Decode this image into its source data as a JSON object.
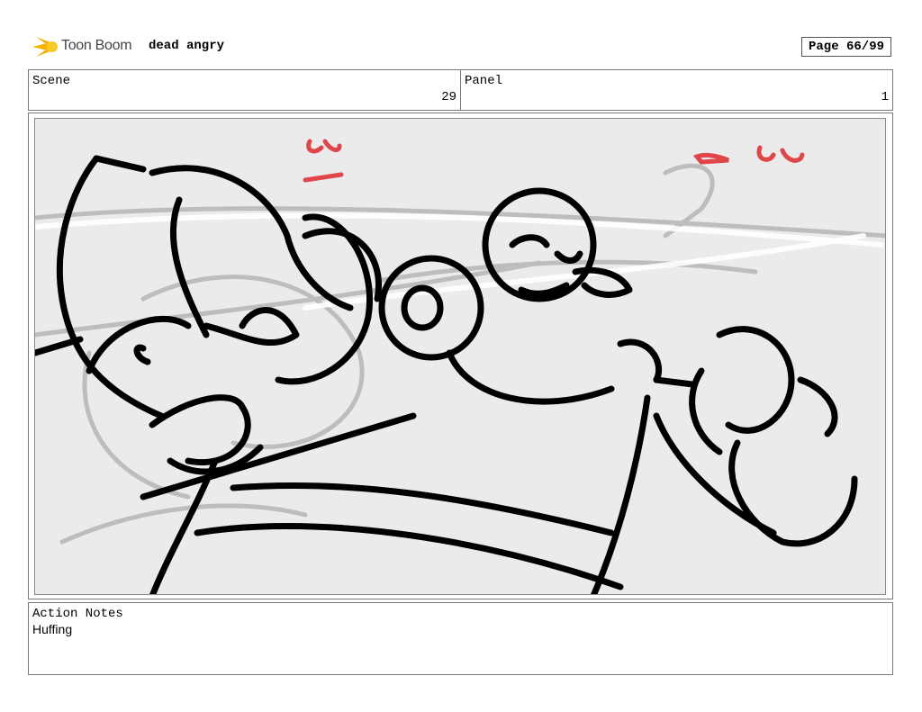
{
  "header": {
    "logo_text": "Toon Boom",
    "project_title": "dead angry",
    "page_label": "Page 66/99"
  },
  "scene": {
    "label": "Scene",
    "value": "29"
  },
  "panel": {
    "label": "Panel",
    "value": "1"
  },
  "action_notes": {
    "label": "Action Notes",
    "text": "Huffing"
  },
  "colors": {
    "sketch_ink": "#000000",
    "rough_sketch": "#b8b8b8",
    "bg_note_red": "#e0454a",
    "panel_bg": "#ebebeb"
  }
}
